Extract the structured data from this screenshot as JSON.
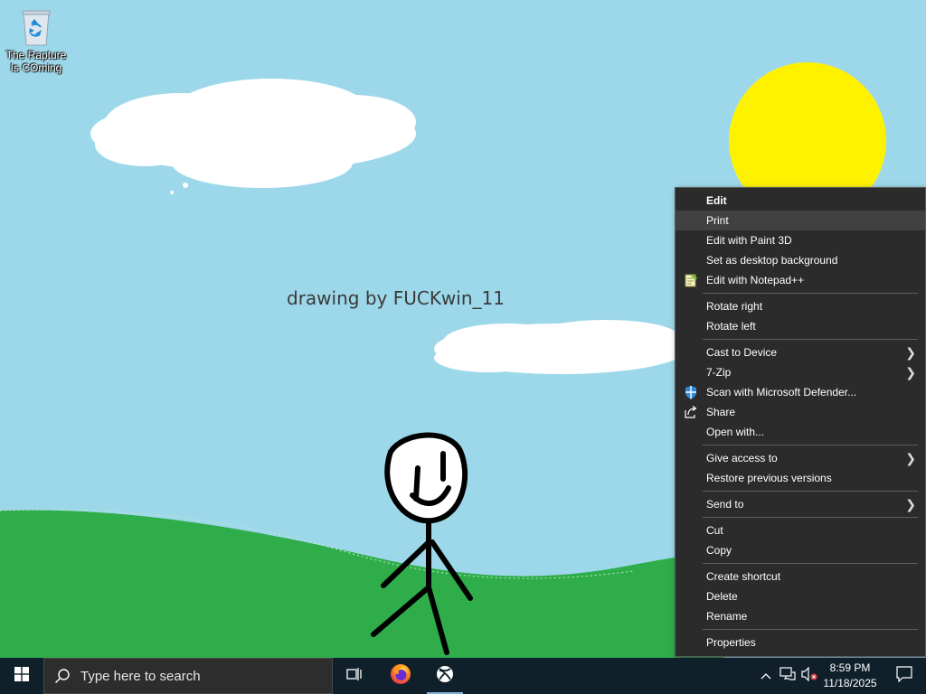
{
  "desktop": {
    "icon_label": "The Rapture Is COming",
    "wallpaper_caption": "drawing by FUCKwin_11"
  },
  "context_menu": {
    "items": [
      {
        "label": "Edit",
        "bold": true
      },
      {
        "label": "Print",
        "hover": true
      },
      {
        "label": "Edit with Paint 3D"
      },
      {
        "label": "Set as desktop background"
      },
      {
        "label": "Edit with Notepad++",
        "icon": "notepadpp-icon"
      },
      {
        "separator": true
      },
      {
        "label": "Rotate right"
      },
      {
        "label": "Rotate left"
      },
      {
        "separator": true
      },
      {
        "label": "Cast to Device",
        "submenu": true
      },
      {
        "label": "7-Zip",
        "submenu": true
      },
      {
        "label": "Scan with Microsoft Defender...",
        "icon": "defender-shield-icon"
      },
      {
        "label": "Share",
        "icon": "share-icon"
      },
      {
        "label": "Open with..."
      },
      {
        "separator": true
      },
      {
        "label": "Give access to",
        "submenu": true
      },
      {
        "label": "Restore previous versions"
      },
      {
        "separator": true
      },
      {
        "label": "Send to",
        "submenu": true
      },
      {
        "separator": true
      },
      {
        "label": "Cut"
      },
      {
        "label": "Copy"
      },
      {
        "separator": true
      },
      {
        "label": "Create shortcut"
      },
      {
        "label": "Delete"
      },
      {
        "label": "Rename"
      },
      {
        "separator": true
      },
      {
        "label": "Properties"
      }
    ]
  },
  "taskbar": {
    "search_placeholder": "Type here to search",
    "pinned": [
      {
        "name": "task-view-icon"
      },
      {
        "name": "firefox-icon"
      },
      {
        "name": "xbox-icon",
        "active": true
      }
    ],
    "tray": {
      "time": "8:59 PM",
      "date": "11/18/2025"
    }
  },
  "colors": {
    "sky": "#9dd8ea",
    "grass": "#2fad4a",
    "sun": "#fff200",
    "menu_bg": "#2b2b2b",
    "taskbar_bg": "#10202a"
  }
}
